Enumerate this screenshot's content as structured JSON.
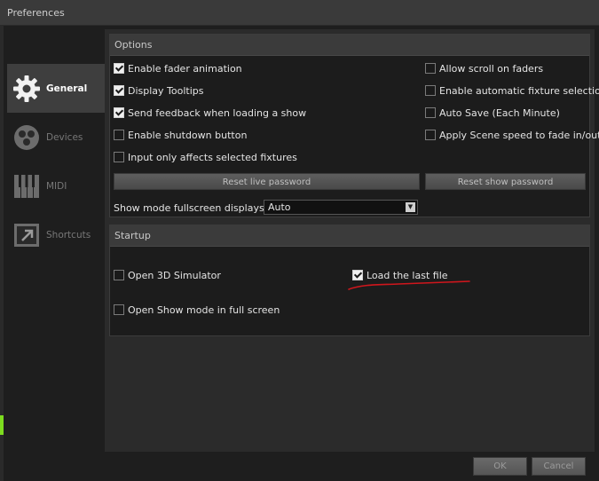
{
  "window": {
    "title": "Preferences"
  },
  "sidebar": {
    "items": [
      {
        "label": "General",
        "icon": "gear-icon",
        "active": true
      },
      {
        "label": "Devices",
        "icon": "devices-icon",
        "active": false
      },
      {
        "label": "MIDI",
        "icon": "piano-icon",
        "active": false
      },
      {
        "label": "Shortcuts",
        "icon": "shortcut-arrow-icon",
        "active": false
      }
    ]
  },
  "options": {
    "header": "Options",
    "checkboxes": {
      "fader_animation": {
        "label": "Enable fader animation",
        "checked": true
      },
      "display_tooltips": {
        "label": "Display Tooltips",
        "checked": true
      },
      "send_feedback": {
        "label": "Send feedback when loading a show",
        "checked": true
      },
      "shutdown_button": {
        "label": "Enable shutdown button",
        "checked": false
      },
      "input_only": {
        "label": "Input only affects selected fixtures",
        "checked": false
      },
      "allow_scroll": {
        "label": "Allow scroll on faders",
        "checked": false
      },
      "auto_fixture": {
        "label": "Enable automatic fixture selection",
        "checked": false
      },
      "auto_save": {
        "label": "Auto Save (Each Minute)",
        "checked": false
      },
      "scene_speed": {
        "label": "Apply Scene speed to fade in/out",
        "checked": false
      }
    },
    "reset_live_label": "Reset live password",
    "reset_show_label": "Reset show password",
    "fullscreen_label": "Show mode fullscreen displays on:",
    "fullscreen_value": "Auto"
  },
  "startup": {
    "header": "Startup",
    "open_3d": {
      "label": "Open 3D Simulator",
      "checked": false
    },
    "load_last": {
      "label": "Load the last file",
      "checked": true
    },
    "show_fullscreen": {
      "label": "Open Show mode in full screen",
      "checked": false
    }
  },
  "footer": {
    "ok_label": "OK",
    "cancel_label": "Cancel"
  },
  "colors": {
    "annotation": "#d0161c",
    "accent_green": "#7ddc1f"
  }
}
